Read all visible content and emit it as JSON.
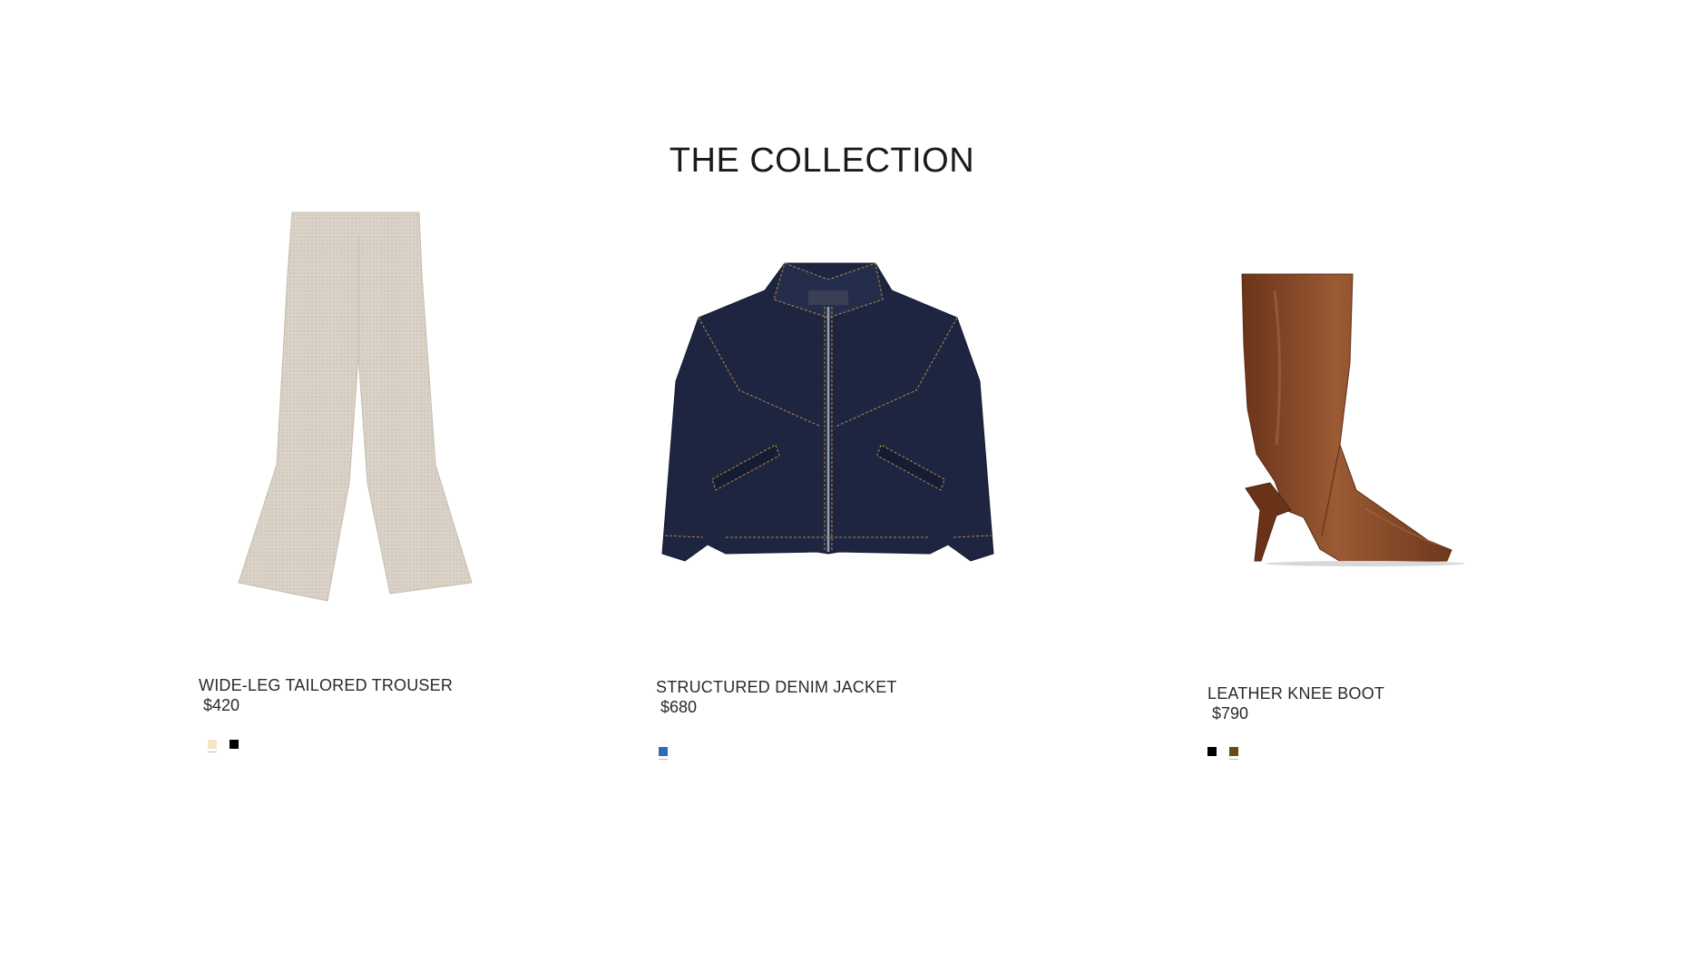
{
  "page": {
    "title": "THE COLLECTION"
  },
  "products": [
    {
      "name": "WIDE-LEG TAILORED TROUSER",
      "price": "$420",
      "image_icon": "trouser-image",
      "swatches": [
        {
          "name": "cream",
          "color": "#f3e6c4",
          "active": true
        },
        {
          "name": "black",
          "color": "#000000",
          "active": false
        }
      ]
    },
    {
      "name": "STRUCTURED DENIM JACKET",
      "price": "$680",
      "image_icon": "denim-jacket-image",
      "swatches": [
        {
          "name": "blue",
          "color": "#2f6db3",
          "active": true
        }
      ]
    },
    {
      "name": "LEATHER KNEE BOOT",
      "price": "$790",
      "image_icon": "knee-boot-image",
      "swatches": [
        {
          "name": "black",
          "color": "#000000",
          "active": false
        },
        {
          "name": "brown",
          "color": "#6b4a1a",
          "active": true
        }
      ]
    }
  ],
  "colors": {
    "trouser": "#d8d0c4",
    "trouser_shadow": "#c9c0b2",
    "jacket": "#1e2540",
    "jacket_stitch": "#b0894a",
    "boot": "#7a3f22",
    "boot_highlight": "#9a5a34"
  }
}
